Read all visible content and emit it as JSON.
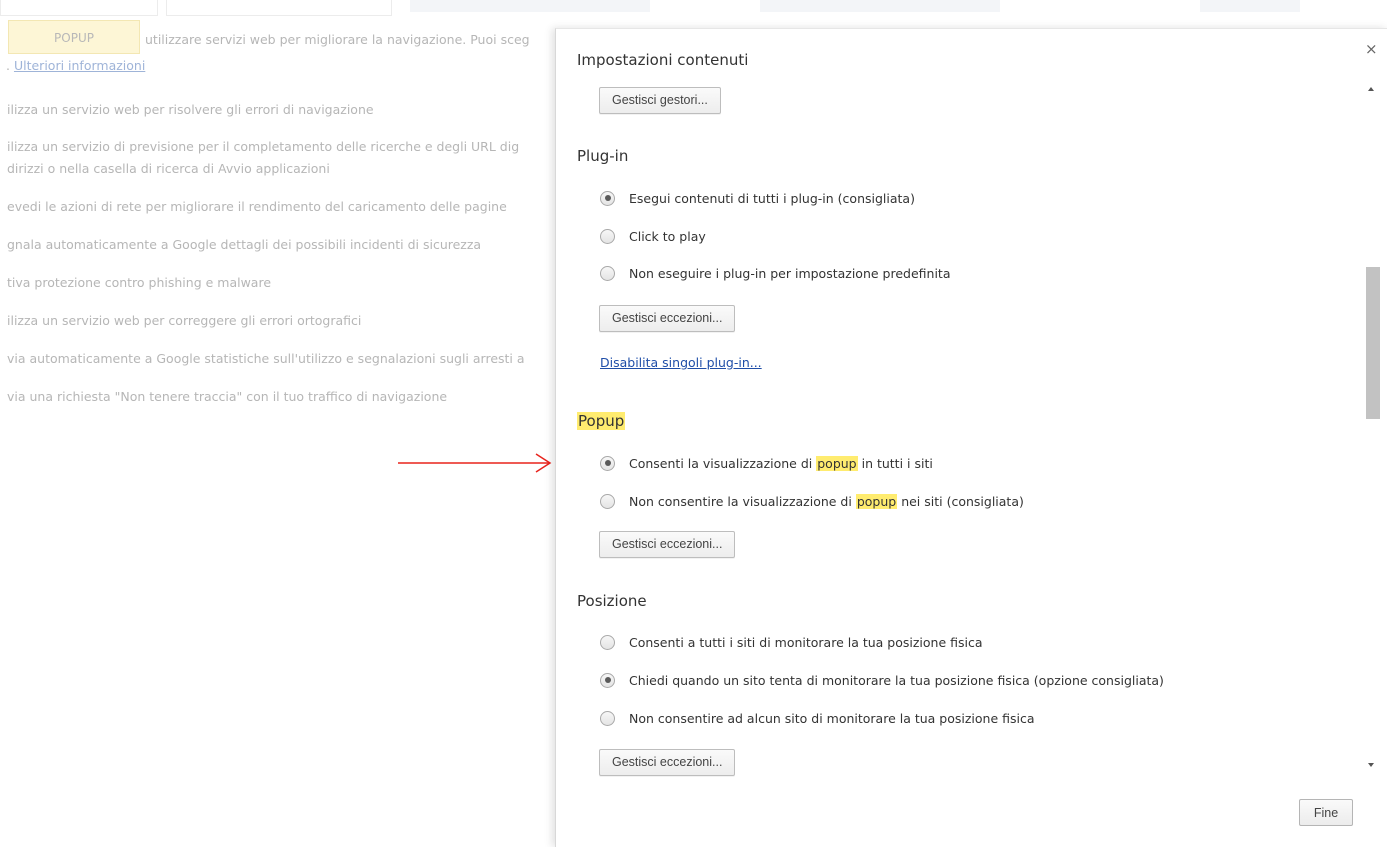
{
  "background": {
    "tooltip": "POPUP",
    "lines": [
      "utilizzare servizi web per migliorare la navigazione. Puoi sceg",
      "Ulteriori informazioni",
      "ilizza un servizio web per risolvere gli errori di navigazione",
      "ilizza un servizio di previsione per il completamento delle ricerche e degli URL dig",
      "dirizzi o nella casella di ricerca di Avvio applicazioni",
      "evedi le azioni di rete per migliorare il rendimento del caricamento delle pagine",
      "gnala automaticamente a Google dettagli dei possibili incidenti di sicurezza",
      "tiva protezione contro phishing e malware",
      "ilizza un servizio web per correggere gli errori ortografici",
      "via automaticamente a Google statistiche sull'utilizzo e segnalazioni sugli arresti a",
      "via una richiesta \"Non tenere traccia\" con il tuo traffico di navigazione"
    ],
    "prefix": "."
  },
  "dialog": {
    "title": "Impostazioni contenuti",
    "close": "×",
    "handlers_button": "Gestisci gestori...",
    "plugin": {
      "heading": "Plug-in",
      "options": [
        "Esegui contenuti di tutti i plug-in (consigliata)",
        "Click to play",
        "Non eseguire i plug-in per impostazione predefinita"
      ],
      "selected": 0,
      "exceptions_button": "Gestisci eccezioni...",
      "disable_link": "Disabilita singoli plug-in..."
    },
    "popup": {
      "heading": "Popup",
      "option1_pre": "Consenti la visualizzazione di",
      "option1_hl": "popup",
      "option1_post": "in tutti i siti",
      "option2_pre": "Non consentire la visualizzazione di",
      "option2_hl": "popup",
      "option2_post": "nei siti (consigliata)",
      "selected": 0,
      "exceptions_button": "Gestisci eccezioni..."
    },
    "position": {
      "heading": "Posizione",
      "options": [
        "Consenti a tutti i siti di monitorare la tua posizione fisica",
        "Chiedi quando un sito tenta di monitorare la tua posizione fisica (opzione consigliata)",
        "Non consentire ad alcun sito di monitorare la tua posizione fisica"
      ],
      "selected": 1,
      "exceptions_button": "Gestisci eccezioni..."
    },
    "done_button": "Fine"
  },
  "colors": {
    "highlight": "#ffec6f",
    "annotation_arrow": "#e8231c",
    "link": "#1f4ea8"
  }
}
